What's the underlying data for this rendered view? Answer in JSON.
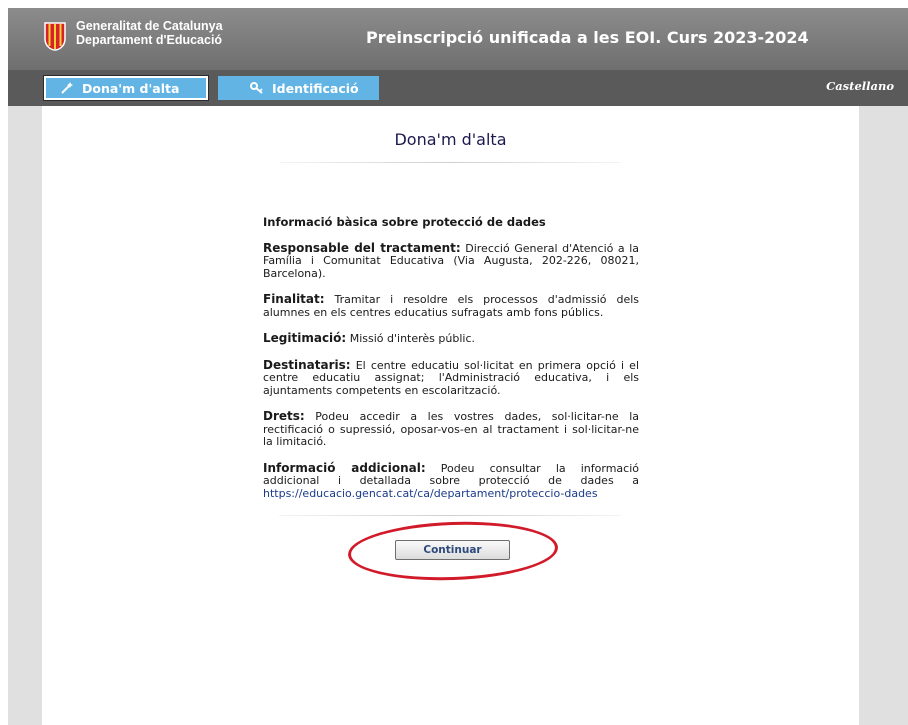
{
  "header": {
    "org_line1": "Generalitat de Catalunya",
    "org_line2": "Departament d'Educació",
    "app_title": "Preinscripció unificada a les EOI. Curs 2023-2024"
  },
  "nav": {
    "tabs": [
      {
        "label": "Dona'm d'alta",
        "icon": "magic-wand-icon"
      },
      {
        "label": "Identificació",
        "icon": "key-icon"
      }
    ],
    "language": "Castellano"
  },
  "main": {
    "title": "Dona'm d'alta",
    "heading": "Informació bàsica sobre protecció de dades",
    "sections": [
      {
        "label": "Responsable del tractament:",
        "text": " Direcció General d'Atenció a la Família i Comunitat Educativa (Via Augusta, 202-226, 08021, Barcelona)."
      },
      {
        "label": "Finalitat:",
        "text": " Tramitar i resoldre els processos d'admissió dels alumnes en els centres educatius sufragats amb fons públics."
      },
      {
        "label": "Legitimació:",
        "text": " Missió d'interès públic."
      },
      {
        "label": "Destinataris:",
        "text": " El centre educatiu sol·licitat en primera opció i el centre educatiu assignat; l'Administració educativa, i els ajuntaments competents en escolarització."
      },
      {
        "label": "Drets:",
        "text": " Podeu accedir a les vostres dades, sol·licitar-ne la rectificació o supressió, oposar-vos-en al tractament i sol·licitar-ne la limitació."
      },
      {
        "label": "Informació addicional:",
        "text": " Podeu consultar la informació addicional i detallada sobre protecció de dades a ",
        "link": "https://educacio.gencat.cat/ca/departament/proteccio-dades"
      }
    ],
    "continue_label": "Continuar"
  },
  "colors": {
    "header_bg": "#7a7a7a",
    "nav_bg": "#5a5a5a",
    "tab_bg": "#62b4e4",
    "title_color": "#1a1a4e",
    "annotation_red": "#d11a2a"
  }
}
